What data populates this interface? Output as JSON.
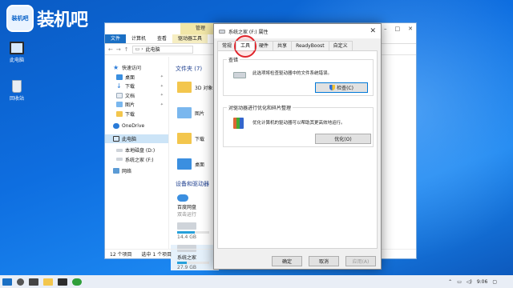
{
  "brand": {
    "logo_text": "装机吧",
    "mark_text": "装机吧"
  },
  "desktop": {
    "icons": [
      {
        "label": "此电脑"
      },
      {
        "label": "回收站"
      }
    ]
  },
  "explorer": {
    "context_tab": "管理",
    "ribbon": [
      "文件",
      "计算机",
      "查看",
      "驱动器工具"
    ],
    "path": "此电脑",
    "nav": [
      {
        "label": "快速访问",
        "selected": false
      },
      {
        "label": "桌面",
        "pin": true
      },
      {
        "label": "下载",
        "pin": true
      },
      {
        "label": "文档",
        "pin": true
      },
      {
        "label": "图片",
        "pin": true
      },
      {
        "label": "下载"
      },
      {
        "label": "OneDrive"
      },
      {
        "label": "此电脑",
        "selected": true
      },
      {
        "label": "本地磁盘 (D:)"
      },
      {
        "label": "系统之家 (F:)"
      },
      {
        "label": "网络"
      }
    ],
    "group_folders": "文件夹 (7)",
    "folders": [
      "3D 对象",
      "图片",
      "下载",
      "桌面"
    ],
    "group_drives": "设备和驱动器",
    "drives": [
      {
        "name": "百度网盘",
        "sub": "双击运行"
      },
      {
        "name": "",
        "free": "14.4 GB",
        "usage": 0.55
      },
      {
        "name": "系统之家",
        "free": "27.9 GB",
        "usage": 0.3
      }
    ],
    "status": {
      "count": "12 个项目",
      "selected": "选中 1 个项目"
    }
  },
  "dialog": {
    "title": "系统之家 (F:) 属性",
    "tabs": [
      "常规",
      "工具",
      "硬件",
      "共享",
      "ReadyBoost",
      "自定义"
    ],
    "active_tab": "工具",
    "check": {
      "header": "查错",
      "text": "此选项将检查驱动器中的文件系统错误。",
      "button": "检查(C)"
    },
    "optimize": {
      "header": "对驱动器进行优化和碎片整理",
      "text": "优化计算机的驱动器可以帮助其更高效地运行。",
      "button": "优化(O)"
    },
    "buttons": {
      "ok": "确定",
      "cancel": "取消",
      "apply": "应用(A)"
    }
  },
  "taskbar": {
    "time": "9:06"
  },
  "colors": {
    "accent": "#0078d7",
    "callout": "#e0242b",
    "ribbon_file": "#1a6fc4",
    "folder": "#f3c64d"
  }
}
